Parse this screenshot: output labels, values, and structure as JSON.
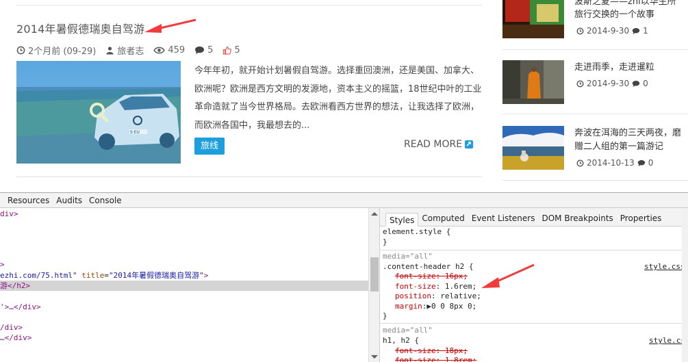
{
  "post": {
    "title": "2014年暑假德瑞奥自驾游",
    "date": "2个月前 (09-29)",
    "author": "旅者志",
    "views": "459",
    "comments": "5",
    "likes": "5",
    "excerpt": "今年年初，就开始计划暑假自驾游。选择重回澳洲，还是美国、加拿大、欧洲呢？欧洲是西方文明的发源地，资本主义的摇篮，18世纪中叶的工业革命造就了当今世界格局。去欧洲看西方世界的想法，让我选择了欧洲，而欧洲各国中，我最想去的...",
    "tag": "旅线",
    "read_more": "READ MORE",
    "thumb_plate": "S·EU"
  },
  "sidebar": {
    "items": [
      {
        "title_line1": "波斯之夏——zhī以华生所 ",
        "title_line2": "旅行交换的一个故事",
        "date": "2014-9-30",
        "comments": "1"
      },
      {
        "title_line1": "走进雨季，走进暹粒",
        "title_line2": "",
        "date": "2014-9-30",
        "comments": "0"
      },
      {
        "title_line1": "奔波在洱海的三天两夜，磨",
        "title_line2": "赠二人组的第一篇游记",
        "date": "2014-10-13",
        "comments": "0"
      }
    ]
  },
  "devtools": {
    "tabs": [
      "Resources",
      "Audits",
      "Console"
    ],
    "style_tabs": [
      "Styles",
      "Computed",
      "Event Listeners",
      "DOM Breakpoints",
      "Properties"
    ],
    "elements": {
      "l1": "div>",
      "l5": ">",
      "l6_text": "ezhi.com/75.html",
      "l6_attr": "title",
      "l6_val": "\"2014年暑假德瑞奥自驾游\"",
      "l7": "游</h2>",
      "l9": "'>…</div>",
      "l11": "/div>",
      "l12": "…</div>"
    },
    "styles": {
      "element_style": "element.style {",
      "close": "}",
      "media1": "media=\"all\"",
      "selector1": ".content-header h2 {",
      "source1": "style.css",
      "p1": "font-size: 16px;",
      "p2_name": "font-size",
      "p2_val": ": 1.6rem;",
      "p3_name": "position",
      "p3_val": ": relative;",
      "p4_name": "margin",
      "p4_val": ":▶0 0 8px 0;",
      "media2": "media=\"all\"",
      "selector2": "h1, h2 {",
      "source2": "style.css",
      "p5": "font-size: 18px;",
      "p6": "font-size: 1.8rem;"
    }
  },
  "colors": {
    "accent": "#1e9fdd",
    "arrow": "#f03c3c",
    "tag_name": "#881280",
    "attr_name": "#994500",
    "attr_value": "#1a1aa6",
    "css_prop": "#c80000"
  }
}
